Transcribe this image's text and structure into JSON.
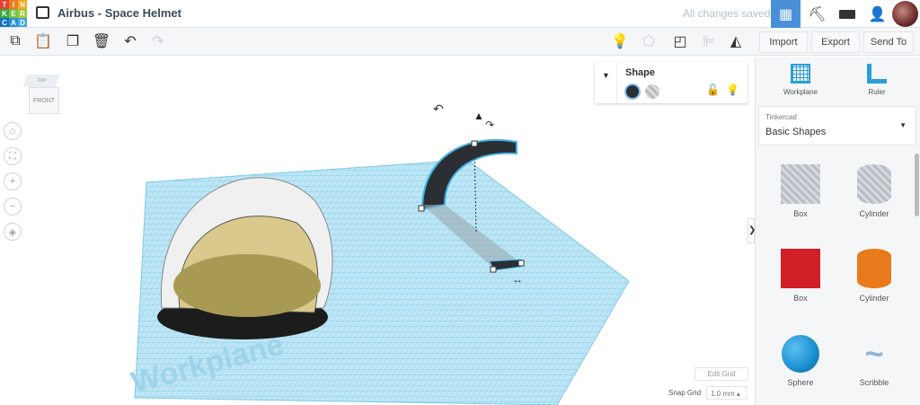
{
  "app": {
    "logo_letters": [
      "T",
      "I",
      "N",
      "K",
      "E",
      "R",
      "C",
      "A",
      "D"
    ],
    "title": "Airbus - Space Helmet",
    "save_status": "All changes saved"
  },
  "toolbar": {
    "import": "Import",
    "export": "Export",
    "send_to": "Send To"
  },
  "inspector": {
    "title": "Shape"
  },
  "panel": {
    "workplane": "Workplane",
    "ruler": "Ruler",
    "library_label": "Tinkercad",
    "library_value": "Basic Shapes",
    "shapes": [
      {
        "label": "Box",
        "color": "#c9ced6"
      },
      {
        "label": "Cylinder",
        "color": "#c9ced6"
      },
      {
        "label": "Box",
        "color": "#d11f27"
      },
      {
        "label": "Cylinder",
        "color": "#e87a1c"
      },
      {
        "label": "Sphere",
        "color": "#1a8fd0"
      },
      {
        "label": "Scribble",
        "color": "#8fb4d6"
      }
    ]
  },
  "viewcube": {
    "top": "TOP",
    "front": "FRONT"
  },
  "workplane_label": "Workplane",
  "grid": {
    "edit": "Edit Grid",
    "snap_label": "Snap Grid",
    "snap_value": "1.0 mm ▴"
  }
}
